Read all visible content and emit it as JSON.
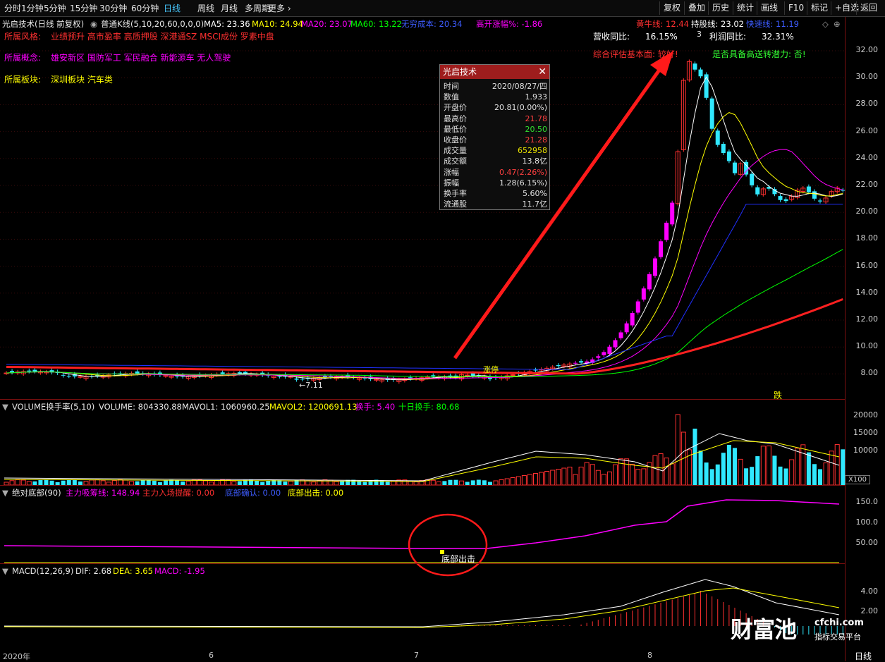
{
  "toolbar": {
    "left": [
      "分时",
      "1分钟",
      "5分钟",
      "15分钟",
      "30分钟",
      "60分钟",
      "日线",
      "周线",
      "月线",
      "多周期",
      "更多"
    ],
    "active": "日线",
    "right": [
      "复权",
      "叠加",
      "历史",
      "统计",
      "画线",
      "F10",
      "标记",
      "+自选",
      "返回"
    ]
  },
  "header": {
    "title": "光启技术(日线 前复权)",
    "style_label": "普通K线(5,10,20,60,0,0,0)",
    "ma5": "MA5: 23.36",
    "ma10": "MA10: 24.94",
    "ma20": "MA20: 23.07",
    "ma60": "MA60: 13.22",
    "cost": "无穷成本: 20.34",
    "gap": "高开涨幅%: -1.86",
    "bull": "黄牛线: 12.44",
    "hold": "持股线: 23.02",
    "fast": "快速线: 11.19"
  },
  "info": {
    "style_label": "所属风格:",
    "style_value": "业绩预升 高市盈率 高质押股 深港通SZ MSCI成份 罗素中盘",
    "concept_label": "所属概念:",
    "concept_value": "雄安新区 国防军工 军民融合 新能源车 无人驾驶",
    "sector_label": "所属板块:",
    "sector_value": "深圳板块    汽车类",
    "rev_label": "营收同比:",
    "rev_value": "16.15%",
    "profit_label": "利润同比:",
    "profit_value": "32.31%",
    "eval": "综合评估基本面: 较好!",
    "potential": "是否具备高送转潜力: 否!"
  },
  "popup": {
    "title": "光启技术",
    "rows": [
      {
        "label": "时间",
        "value": "2020/08/27/四",
        "color": "#e0e0e0"
      },
      {
        "label": "数值",
        "value": "1.933",
        "color": "#e0e0e0"
      },
      {
        "label": "开盘价",
        "value": "20.81(0.00%)",
        "color": "#e0e0e0"
      },
      {
        "label": "最高价",
        "value": "21.78",
        "color": "#ff4040"
      },
      {
        "label": "最低价",
        "value": "20.50",
        "color": "#30e030"
      },
      {
        "label": "收盘价",
        "value": "21.28",
        "color": "#ff4040"
      },
      {
        "label": "成交量",
        "value": "652958",
        "color": "#e8e000"
      },
      {
        "label": "成交额",
        "value": "13.8亿",
        "color": "#e0e0e0"
      },
      {
        "label": "涨幅",
        "value": "0.47(2.26%)",
        "color": "#ff4040"
      },
      {
        "label": "振幅",
        "value": "1.28(6.15%)",
        "color": "#e0e0e0"
      },
      {
        "label": "换手率",
        "value": "5.60%",
        "color": "#e0e0e0"
      },
      {
        "label": "流通股",
        "value": "11.7亿",
        "color": "#e0e0e0"
      }
    ]
  },
  "price_axis": [
    "32.00",
    "30.00",
    "28.00",
    "26.00",
    "24.00",
    "22.00",
    "20.00",
    "18.00",
    "16.00",
    "14.00",
    "12.00",
    "10.00",
    "8.00"
  ],
  "annotations": {
    "low": "←7.11",
    "high": "3",
    "drop": "跌",
    "zhangting": "涨停"
  },
  "volume": {
    "title": "VOLUME换手率(5,10)",
    "vol": "VOLUME: 804330.88",
    "mavol1": "MAVOL1: 1060960.25",
    "mavol2": "MAVOL2: 1200691.13",
    "turnover": "换手: 5.40",
    "ten_day": "十日换手: 80.68",
    "axis": [
      "20000",
      "15000",
      "10000"
    ],
    "unit": "X100"
  },
  "bottom_ind": {
    "title": "绝对底部(90)",
    "main_chip": "主力吸筹线: 148.94",
    "main_entry": "主力入场提醒: 0.00",
    "confirm": "底部确认: 0.00",
    "exit": "底部出击: 0.00",
    "axis": [
      "150.0",
      "100.0",
      "50.00"
    ],
    "marker": "底部出击"
  },
  "macd": {
    "title": "MACD(12,26,9)",
    "dif": "DIF: 2.68",
    "dea": "DEA: 3.65",
    "macd": "MACD: -1.95",
    "axis": [
      "4.00",
      "2.00"
    ]
  },
  "x_axis": [
    "2020年",
    "6",
    "7",
    "8"
  ],
  "period_label": "日线",
  "watermark": {
    "main": "财富池",
    "site": "cfchi.com",
    "sub": "指标交易平台"
  },
  "colors": {
    "up": "#ff3030",
    "down": "#30e8ff",
    "pink": "#ff00ff",
    "ma5": "#ffffff",
    "ma10": "#ffff00",
    "ma20": "#ff00ff",
    "ma60": "#00ff00"
  }
}
